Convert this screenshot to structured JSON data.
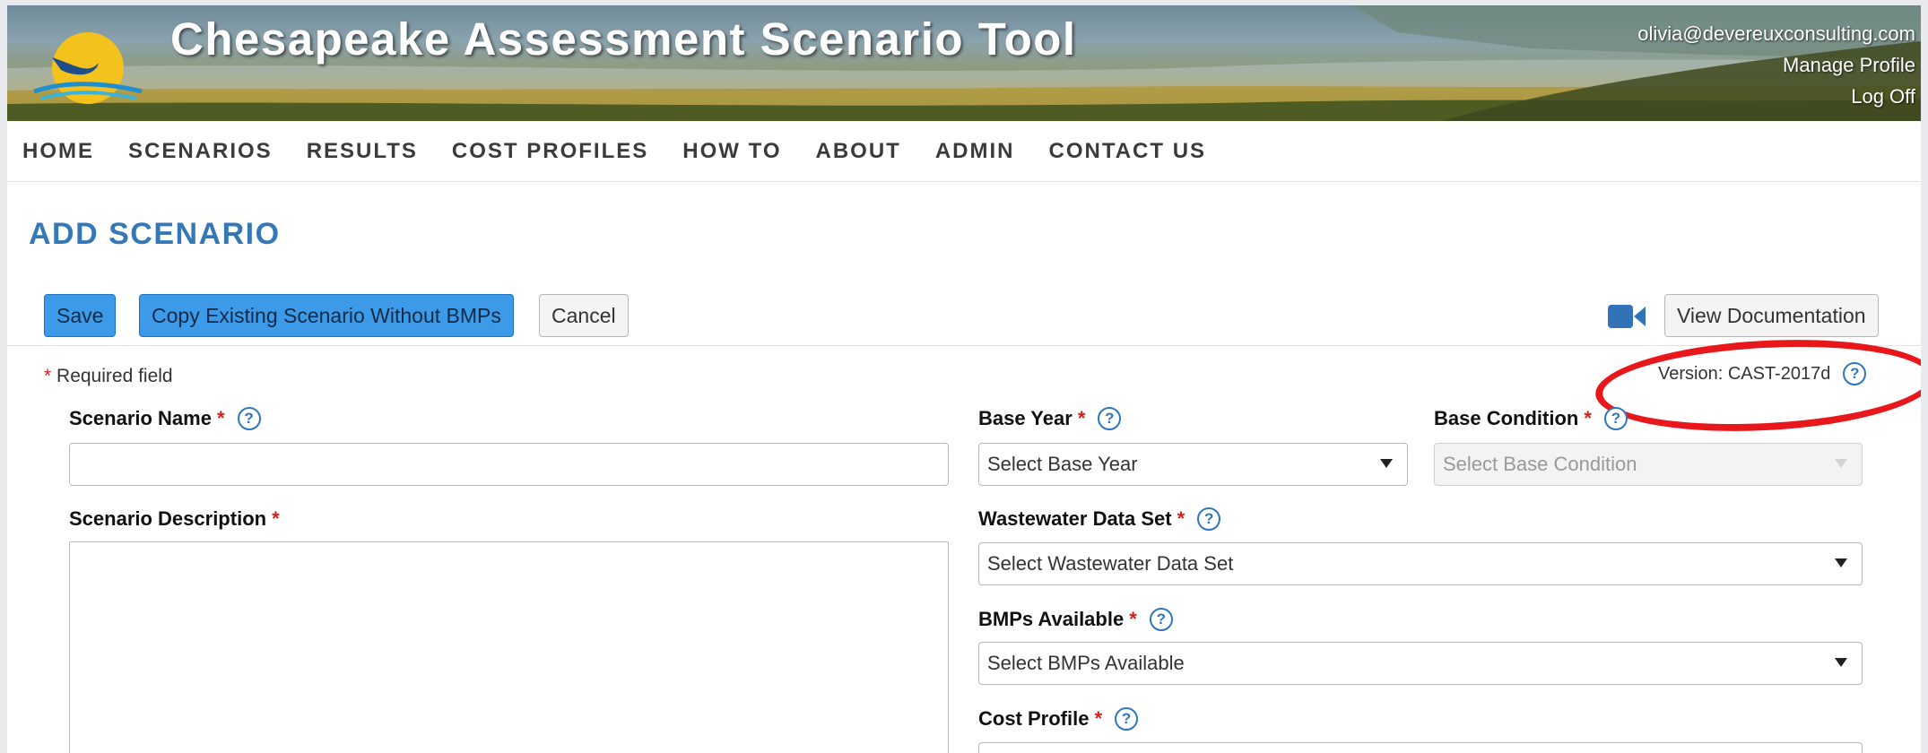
{
  "app": {
    "title": "Chesapeake Assessment Scenario Tool",
    "user_email": "olivia@devereuxconsulting.com",
    "manage_profile": "Manage Profile",
    "log_off": "Log Off"
  },
  "nav": [
    "HOME",
    "SCENARIOS",
    "RESULTS",
    "COST PROFILES",
    "HOW TO",
    "ABOUT",
    "ADMIN",
    "CONTACT US"
  ],
  "page": {
    "heading": "ADD SCENARIO"
  },
  "toolbar": {
    "save": "Save",
    "copy": "Copy Existing Scenario Without BMPs",
    "cancel": "Cancel",
    "view_docs": "View Documentation",
    "video_icon": "video-camera-icon"
  },
  "required": {
    "star": "*",
    "text": "Required field"
  },
  "version": {
    "text": "Version: CAST-2017d"
  },
  "help_glyph": "?",
  "form": {
    "scenario_name": {
      "label": "Scenario Name",
      "value": ""
    },
    "scenario_description": {
      "label": "Scenario Description",
      "value": ""
    },
    "base_year": {
      "label": "Base Year",
      "selected": "Select Base Year"
    },
    "base_condition": {
      "label": "Base Condition",
      "selected": "Select Base Condition"
    },
    "wastewater": {
      "label": "Wastewater Data Set",
      "selected": "Select Wastewater Data Set"
    },
    "bmps": {
      "label": "BMPs Available",
      "selected": "Select BMPs Available"
    },
    "cost_profile": {
      "label": "Cost Profile",
      "selected": ""
    }
  },
  "colors": {
    "accent": "#3478b8",
    "primary_button": "#3d9ae8",
    "required": "#d3201b",
    "annotation": "#e8171c"
  }
}
